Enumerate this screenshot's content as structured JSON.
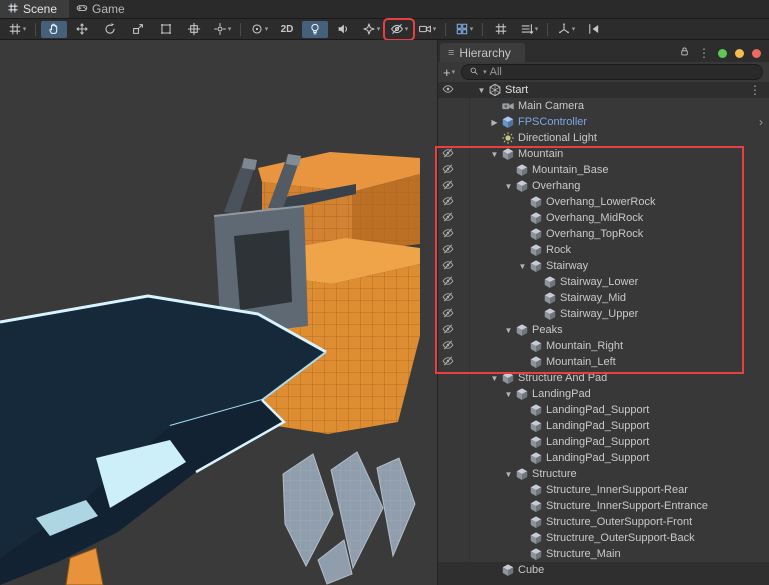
{
  "tabs": {
    "scene": "Scene",
    "game": "Game"
  },
  "toolbar": {
    "buttons": [
      {
        "name": "snap-settings",
        "icon": "grid",
        "caret": true
      },
      {
        "sep": true
      },
      {
        "name": "view-hand-tool",
        "icon": "hand",
        "active": true
      },
      {
        "name": "move-tool",
        "icon": "move"
      },
      {
        "name": "rotate-tool",
        "icon": "rotate"
      },
      {
        "name": "scale-tool",
        "icon": "scale"
      },
      {
        "name": "rect-tool",
        "icon": "rect"
      },
      {
        "name": "transform-tool",
        "icon": "transform"
      },
      {
        "name": "custom-tool",
        "icon": "custom",
        "caret": true
      },
      {
        "sep": true
      },
      {
        "name": "pivot-toggle",
        "icon": "pivot",
        "caret": true
      },
      {
        "name": "2d-toggle",
        "label": "2D"
      },
      {
        "name": "lighting-toggle",
        "icon": "bulb",
        "active": true
      },
      {
        "name": "audio-toggle",
        "icon": "speaker"
      },
      {
        "name": "effects-toggle",
        "icon": "effects",
        "caret": true
      },
      {
        "name": "scene-visibility-toggle",
        "icon": "eyeoff",
        "caret": true,
        "boxed": true
      },
      {
        "name": "camera-preview",
        "icon": "cameraT",
        "caret": true
      },
      {
        "sep": true
      },
      {
        "name": "split-view",
        "icon": "split",
        "caret": true,
        "accent": true
      },
      {
        "sep": true
      },
      {
        "name": "grid-visibility",
        "icon": "grid"
      },
      {
        "name": "snap-increment",
        "icon": "increment",
        "caret": true
      },
      {
        "sep": true
      },
      {
        "name": "gizmos-menu",
        "icon": "gizmo",
        "caret": true
      },
      {
        "name": "frame-skip",
        "icon": "skip"
      }
    ]
  },
  "hierarchy": {
    "tab_label": "Hierarchy",
    "add_button": "+",
    "search": {
      "filter_label": "All"
    },
    "scene_row": {
      "name": "Start"
    },
    "rows": [
      {
        "label": "Main Camera",
        "level": 1,
        "icon": "camera",
        "foldout": "none",
        "hidden": false
      },
      {
        "label": "FPSController",
        "level": 1,
        "icon": "prefab",
        "foldout": "collapsed",
        "hidden": false,
        "prefab": true,
        "chevron": true
      },
      {
        "label": "Directional Light",
        "level": 1,
        "icon": "light",
        "foldout": "none",
        "hidden": false
      },
      {
        "label": "Mountain",
        "level": 1,
        "icon": "cube",
        "foldout": "expanded",
        "hidden": true
      },
      {
        "label": "Mountain_Base",
        "level": 2,
        "icon": "cube",
        "foldout": "none",
        "hidden": true
      },
      {
        "label": "Overhang",
        "level": 2,
        "icon": "cube",
        "foldout": "expanded",
        "hidden": true
      },
      {
        "label": "Overhang_LowerRock",
        "level": 3,
        "icon": "cube",
        "foldout": "none",
        "hidden": true
      },
      {
        "label": "Overhang_MidRock",
        "level": 3,
        "icon": "cube",
        "foldout": "none",
        "hidden": true
      },
      {
        "label": "Overhang_TopRock",
        "level": 3,
        "icon": "cube",
        "foldout": "none",
        "hidden": true
      },
      {
        "label": "Rock",
        "level": 3,
        "icon": "cube",
        "foldout": "none",
        "hidden": true
      },
      {
        "label": "Stairway",
        "level": 3,
        "icon": "cube",
        "foldout": "expanded",
        "hidden": true
      },
      {
        "label": "Stairway_Lower",
        "level": 4,
        "icon": "cube",
        "foldout": "none",
        "hidden": true
      },
      {
        "label": "Stairway_Mid",
        "level": 4,
        "icon": "cube",
        "foldout": "none",
        "hidden": true
      },
      {
        "label": "Stairway_Upper",
        "level": 4,
        "icon": "cube",
        "foldout": "none",
        "hidden": true
      },
      {
        "label": "Peaks",
        "level": 2,
        "icon": "cube",
        "foldout": "expanded",
        "hidden": true
      },
      {
        "label": "Mountain_Right",
        "level": 3,
        "icon": "cube",
        "foldout": "none",
        "hidden": true
      },
      {
        "label": "Mountain_Left",
        "level": 3,
        "icon": "cube",
        "foldout": "none",
        "hidden": true
      },
      {
        "label": "Structure And Pad",
        "level": 1,
        "icon": "cube",
        "foldout": "expanded",
        "hidden": false
      },
      {
        "label": "LandingPad",
        "level": 2,
        "icon": "cube",
        "foldout": "expanded",
        "hidden": false
      },
      {
        "label": "LandingPad_Support",
        "level": 3,
        "icon": "cube",
        "foldout": "none",
        "hidden": false
      },
      {
        "label": "LandingPad_Support",
        "level": 3,
        "icon": "cube",
        "foldout": "none",
        "hidden": false
      },
      {
        "label": "LandingPad_Support",
        "level": 3,
        "icon": "cube",
        "foldout": "none",
        "hidden": false
      },
      {
        "label": "LandingPad_Support",
        "level": 3,
        "icon": "cube",
        "foldout": "none",
        "hidden": false
      },
      {
        "label": "Structure",
        "level": 2,
        "icon": "cube",
        "foldout": "expanded",
        "hidden": false
      },
      {
        "label": "Structure_InnerSupport-Rear",
        "level": 3,
        "icon": "cube",
        "foldout": "none",
        "hidden": false
      },
      {
        "label": "Structure_InnerSupport-Entrance",
        "level": 3,
        "icon": "cube",
        "foldout": "none",
        "hidden": false
      },
      {
        "label": "Structure_OuterSupport-Front",
        "level": 3,
        "icon": "cube",
        "foldout": "none",
        "hidden": false
      },
      {
        "label": "Structrure_OuterSupport-Back",
        "level": 3,
        "icon": "cube",
        "foldout": "none",
        "hidden": false
      },
      {
        "label": "Structure_Main",
        "level": 3,
        "icon": "cube",
        "foldout": "none",
        "hidden": false
      },
      {
        "label": "Cube",
        "level": 1,
        "icon": "cube",
        "foldout": "none",
        "hidden": false,
        "darker": true
      }
    ]
  },
  "colors": {
    "annotation_red": "#E84040",
    "prefab_blue": "#7CA7E6",
    "active_toggle_bg": "#46607C",
    "accent_blue": "#7FB2E5",
    "window_traffic_dots": [
      "#61C554",
      "#F5BD4F",
      "#ED6A5E"
    ]
  }
}
